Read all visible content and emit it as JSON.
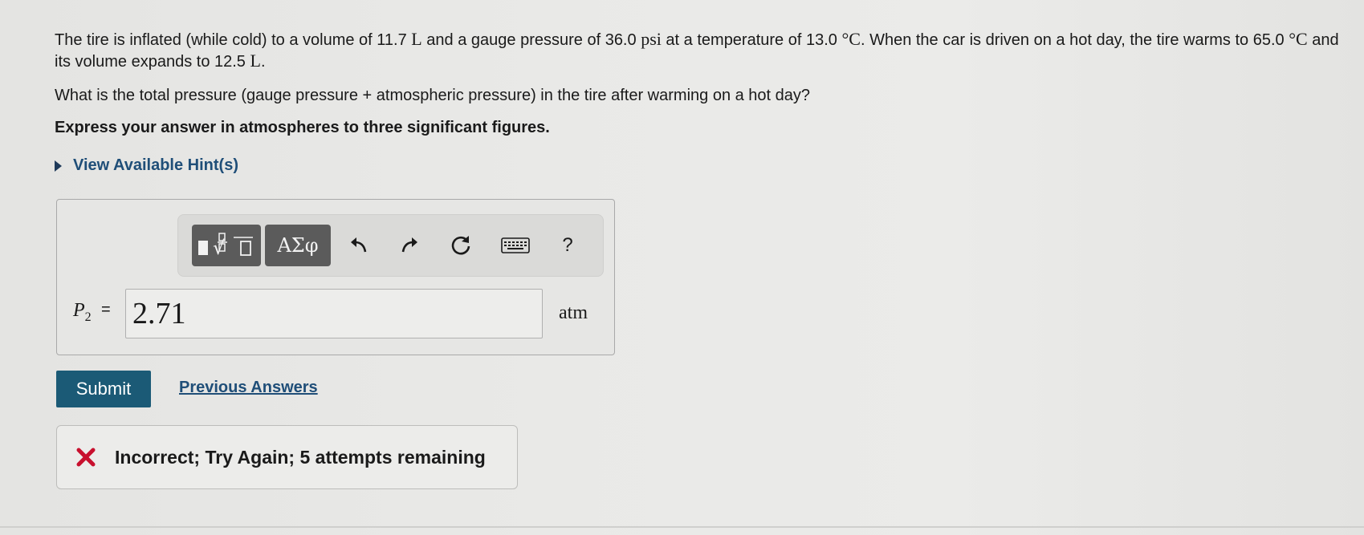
{
  "problem": {
    "p1": "The tire is inflated (while cold) to a volume of 11.7",
    "u1": "L",
    "p2": " and a gauge pressure of 36.0",
    "u2": "psi",
    "p3": " at a temperature of 13.0",
    "u3": "°C",
    "p4": ". When the car is driven on a hot day, the tire warms to 65.0",
    "u4": "°C",
    "p5": " and its volume expands to 12.5",
    "u5": "L",
    "p6": "."
  },
  "question": "What is the total pressure (gauge pressure + atmospheric pressure) in the tire after warming on a hot day?",
  "instruction": "Express your answer in atmospheres to three significant figures.",
  "hint_label": "View Available Hint(s)",
  "toolbar": {
    "greek_label": "ΑΣφ",
    "help_label": "?"
  },
  "answer": {
    "variable": "P",
    "subscript": "2",
    "equals": "=",
    "value": "2.71",
    "unit": "atm"
  },
  "submit_label": "Submit",
  "previous_answers_label": "Previous Answers",
  "feedback": {
    "message": "Incorrect; Try Again; 5 attempts remaining",
    "icon_color": "#c8102e"
  },
  "colors": {
    "link": "#1f4e78",
    "submit_bg": "#1b5a76"
  }
}
